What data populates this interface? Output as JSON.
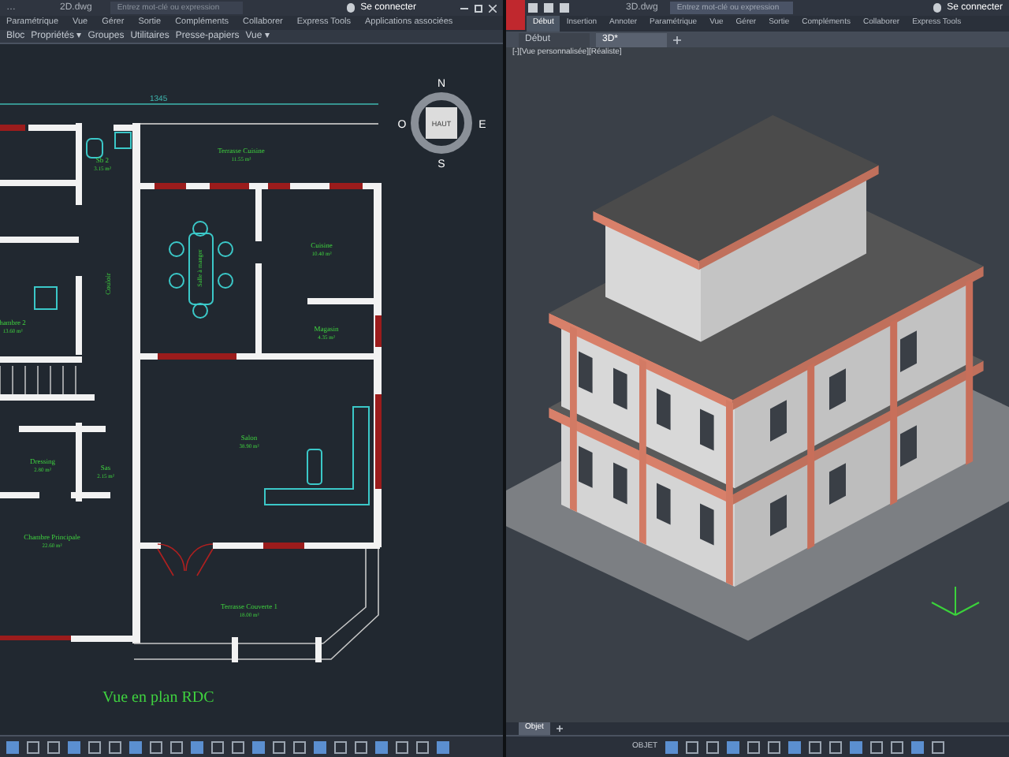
{
  "left_window": {
    "title_prefix": "…",
    "file": "2D.dwg",
    "search": {
      "placeholder": "Entrez mot-clé ou expression"
    },
    "user": "Se connecter",
    "tabs": [
      {
        "label": "Paramétrique",
        "selected": false
      },
      {
        "label": "Vue",
        "selected": false
      },
      {
        "label": "Gérer",
        "selected": false
      },
      {
        "label": "Sortie",
        "selected": false
      },
      {
        "label": "Compléments",
        "selected": false
      },
      {
        "label": "Collaborer",
        "selected": false
      },
      {
        "label": "Express Tools",
        "selected": false
      },
      {
        "label": "Applications associées",
        "selected": false
      }
    ],
    "panels": [
      "Bloc",
      "Propriétés ▾",
      "Groupes",
      "Utilitaires",
      "Presse-papiers",
      "Vue ▾"
    ],
    "compass": {
      "north": "N",
      "south": "S",
      "east": "E",
      "west": "O",
      "top": "HAUT"
    },
    "plan": {
      "dimension": "1345",
      "title": "Vue en plan RDC",
      "rooms": [
        {
          "name": "Sb 2",
          "area": "3.15 m²"
        },
        {
          "name": "Terrasse Cuisine",
          "area": "11.55 m²"
        },
        {
          "name": "Cuisine",
          "area": "10.40 m²"
        },
        {
          "name": "Magasin",
          "area": "4.35 m²"
        },
        {
          "name": "hambre 2",
          "area": "13.60 m²"
        },
        {
          "name": "Salon",
          "area": "38.90 m²"
        },
        {
          "name": "Dressing",
          "area": "2.80 m²"
        },
        {
          "name": "Sas",
          "area": "2.15 m²"
        },
        {
          "name": "Chambre Principale",
          "area": "22.60 m²"
        },
        {
          "name": "Terrasse Couverte 1",
          "area": "18.00 m²"
        }
      ],
      "vertical_labels": [
        "Couloir",
        "Salle à manger"
      ]
    }
  },
  "right_window": {
    "file": "3D.dwg",
    "search": {
      "placeholder": "Entrez mot-clé ou expression"
    },
    "user": "Se connecter",
    "tabs": [
      {
        "label": "Début",
        "selected": true
      },
      {
        "label": "Insertion",
        "selected": false
      },
      {
        "label": "Annoter",
        "selected": false
      },
      {
        "label": "Paramétrique",
        "selected": false
      },
      {
        "label": "Vue",
        "selected": false
      },
      {
        "label": "Gérer",
        "selected": false
      },
      {
        "label": "Sortie",
        "selected": false
      },
      {
        "label": "Compléments",
        "selected": false
      },
      {
        "label": "Collaborer",
        "selected": false
      },
      {
        "label": "Express Tools",
        "selected": false
      }
    ],
    "doc_tabs": [
      {
        "label": "Début",
        "selected": false
      },
      {
        "label": "3D*",
        "selected": true
      }
    ],
    "viewport_label": "[-][Vue personnalisée][Réaliste]",
    "layout_tabs": [
      {
        "label": "Objet",
        "selected": true
      }
    ],
    "status_label": "OBJET"
  }
}
